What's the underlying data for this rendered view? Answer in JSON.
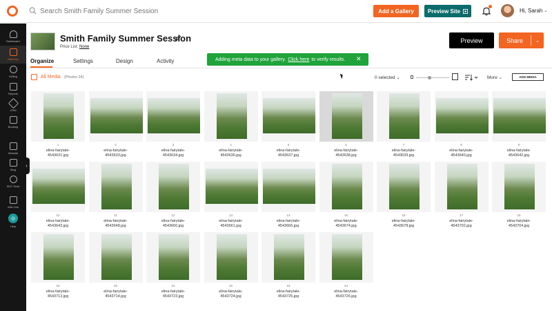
{
  "topbar": {
    "search_placeholder": "Search Smith Family Summer Session",
    "add_gallery_label": "Add a Gallery",
    "preview_site_label": "Preview Site",
    "preview_site_icon": "external-link-icon",
    "user_greeting": "Hi, Sarah",
    "accent": "#f26522",
    "teal": "#0c6b6b"
  },
  "sidebar": {
    "items": [
      {
        "label": "Dashboard",
        "icon": "speedometer-icon"
      },
      {
        "label": "Galleries",
        "icon": "gallery-icon"
      },
      {
        "label": "Selling",
        "icon": "dollar-icon"
      },
      {
        "label": "Reports",
        "icon": "bar-chart-icon"
      },
      {
        "label": "CRM",
        "icon": "paper-plane-icon"
      },
      {
        "label": "Booking",
        "icon": "calendar-icon"
      },
      {
        "label": "Website",
        "icon": "website-icon"
      },
      {
        "label": "Blog",
        "icon": "blog-icon"
      },
      {
        "label": "SEO Tools",
        "icon": "target-icon"
      },
      {
        "label": "Add-Ons",
        "icon": "grid-icon"
      },
      {
        "label": "Help",
        "icon": "help-icon"
      }
    ]
  },
  "gallery": {
    "title": "Smith Family Summer Session",
    "price_list_label": "Price List:",
    "price_list_value": "None",
    "preview_label": "Preview",
    "share_label": "Share"
  },
  "tabs": [
    {
      "label": "Organize"
    },
    {
      "label": "Settings"
    },
    {
      "label": "Design"
    },
    {
      "label": "Activity"
    }
  ],
  "toast": {
    "text_before": "Adding meta data to your gallery.",
    "link": "Click here",
    "text_after": "to verify results.",
    "close": "✕",
    "color": "#1fa33a"
  },
  "media_toolbar": {
    "all_media": "All Media",
    "photos_count": "(Photos 24)",
    "selected": "0 selected ⌄",
    "more": "More ⌄",
    "add_media": "ADD MEDIA"
  },
  "photos": [
    {
      "num": "1",
      "name": "elina-fairytale-4543631.jpg",
      "orient": "portrait"
    },
    {
      "num": "2",
      "name": "elina-fairytale-4543633.jpg",
      "orient": "landscape"
    },
    {
      "num": "3",
      "name": "elina-fairytale-4543634.jpg",
      "orient": "landscape"
    },
    {
      "num": "4",
      "name": "elina-fairytale-4543636.jpg",
      "orient": "portrait"
    },
    {
      "num": "5",
      "name": "elina-fairytale-4543637.jpg",
      "orient": "landscape"
    },
    {
      "num": "6",
      "name": "elina-fairytale-4543638.jpg",
      "orient": "portrait",
      "highlight": true
    },
    {
      "num": "7",
      "name": "elina-fairytale-4543639.jpg",
      "orient": "portrait"
    },
    {
      "num": "8",
      "name": "elina-fairytale-4543640.jpg",
      "orient": "landscape"
    },
    {
      "num": "9",
      "name": "elina-fairytale-4543642.jpg",
      "orient": "landscape"
    },
    {
      "num": "10",
      "name": "elina-fairytale-4543643.jpg",
      "orient": "landscape"
    },
    {
      "num": "11",
      "name": "elina-fairytale-4543648.jpg",
      "orient": "portrait"
    },
    {
      "num": "12",
      "name": "elina-fairytale-4543660.jpg",
      "orient": "portrait"
    },
    {
      "num": "13",
      "name": "elina-fairytale-4543661.jpg",
      "orient": "landscape"
    },
    {
      "num": "14",
      "name": "elina-fairytale-4543666.jpg",
      "orient": "landscape"
    },
    {
      "num": "15",
      "name": "elina-fairytale-4543674.jpg",
      "orient": "portrait"
    },
    {
      "num": "16",
      "name": "elina-fairytale-4543678.jpg",
      "orient": "portrait"
    },
    {
      "num": "17",
      "name": "elina-fairytale-4543702.jpg",
      "orient": "portrait"
    },
    {
      "num": "18",
      "name": "elina-fairytale-4543704.jpg",
      "orient": "portrait"
    },
    {
      "num": "19",
      "name": "elina-fairytale-4543713.jpg",
      "orient": "portrait"
    },
    {
      "num": "20",
      "name": "elina-fairytale-4543714.jpg",
      "orient": "portrait"
    },
    {
      "num": "21",
      "name": "elina-fairytale-4543723.jpg",
      "orient": "portrait"
    },
    {
      "num": "22",
      "name": "elina-fairytale-4543724.jpg",
      "orient": "portrait"
    },
    {
      "num": "23",
      "name": "elina-fairytale-4543725.jpg",
      "orient": "portrait"
    },
    {
      "num": "24",
      "name": "elina-fairytale-4543726.jpg",
      "orient": "portrait"
    }
  ]
}
